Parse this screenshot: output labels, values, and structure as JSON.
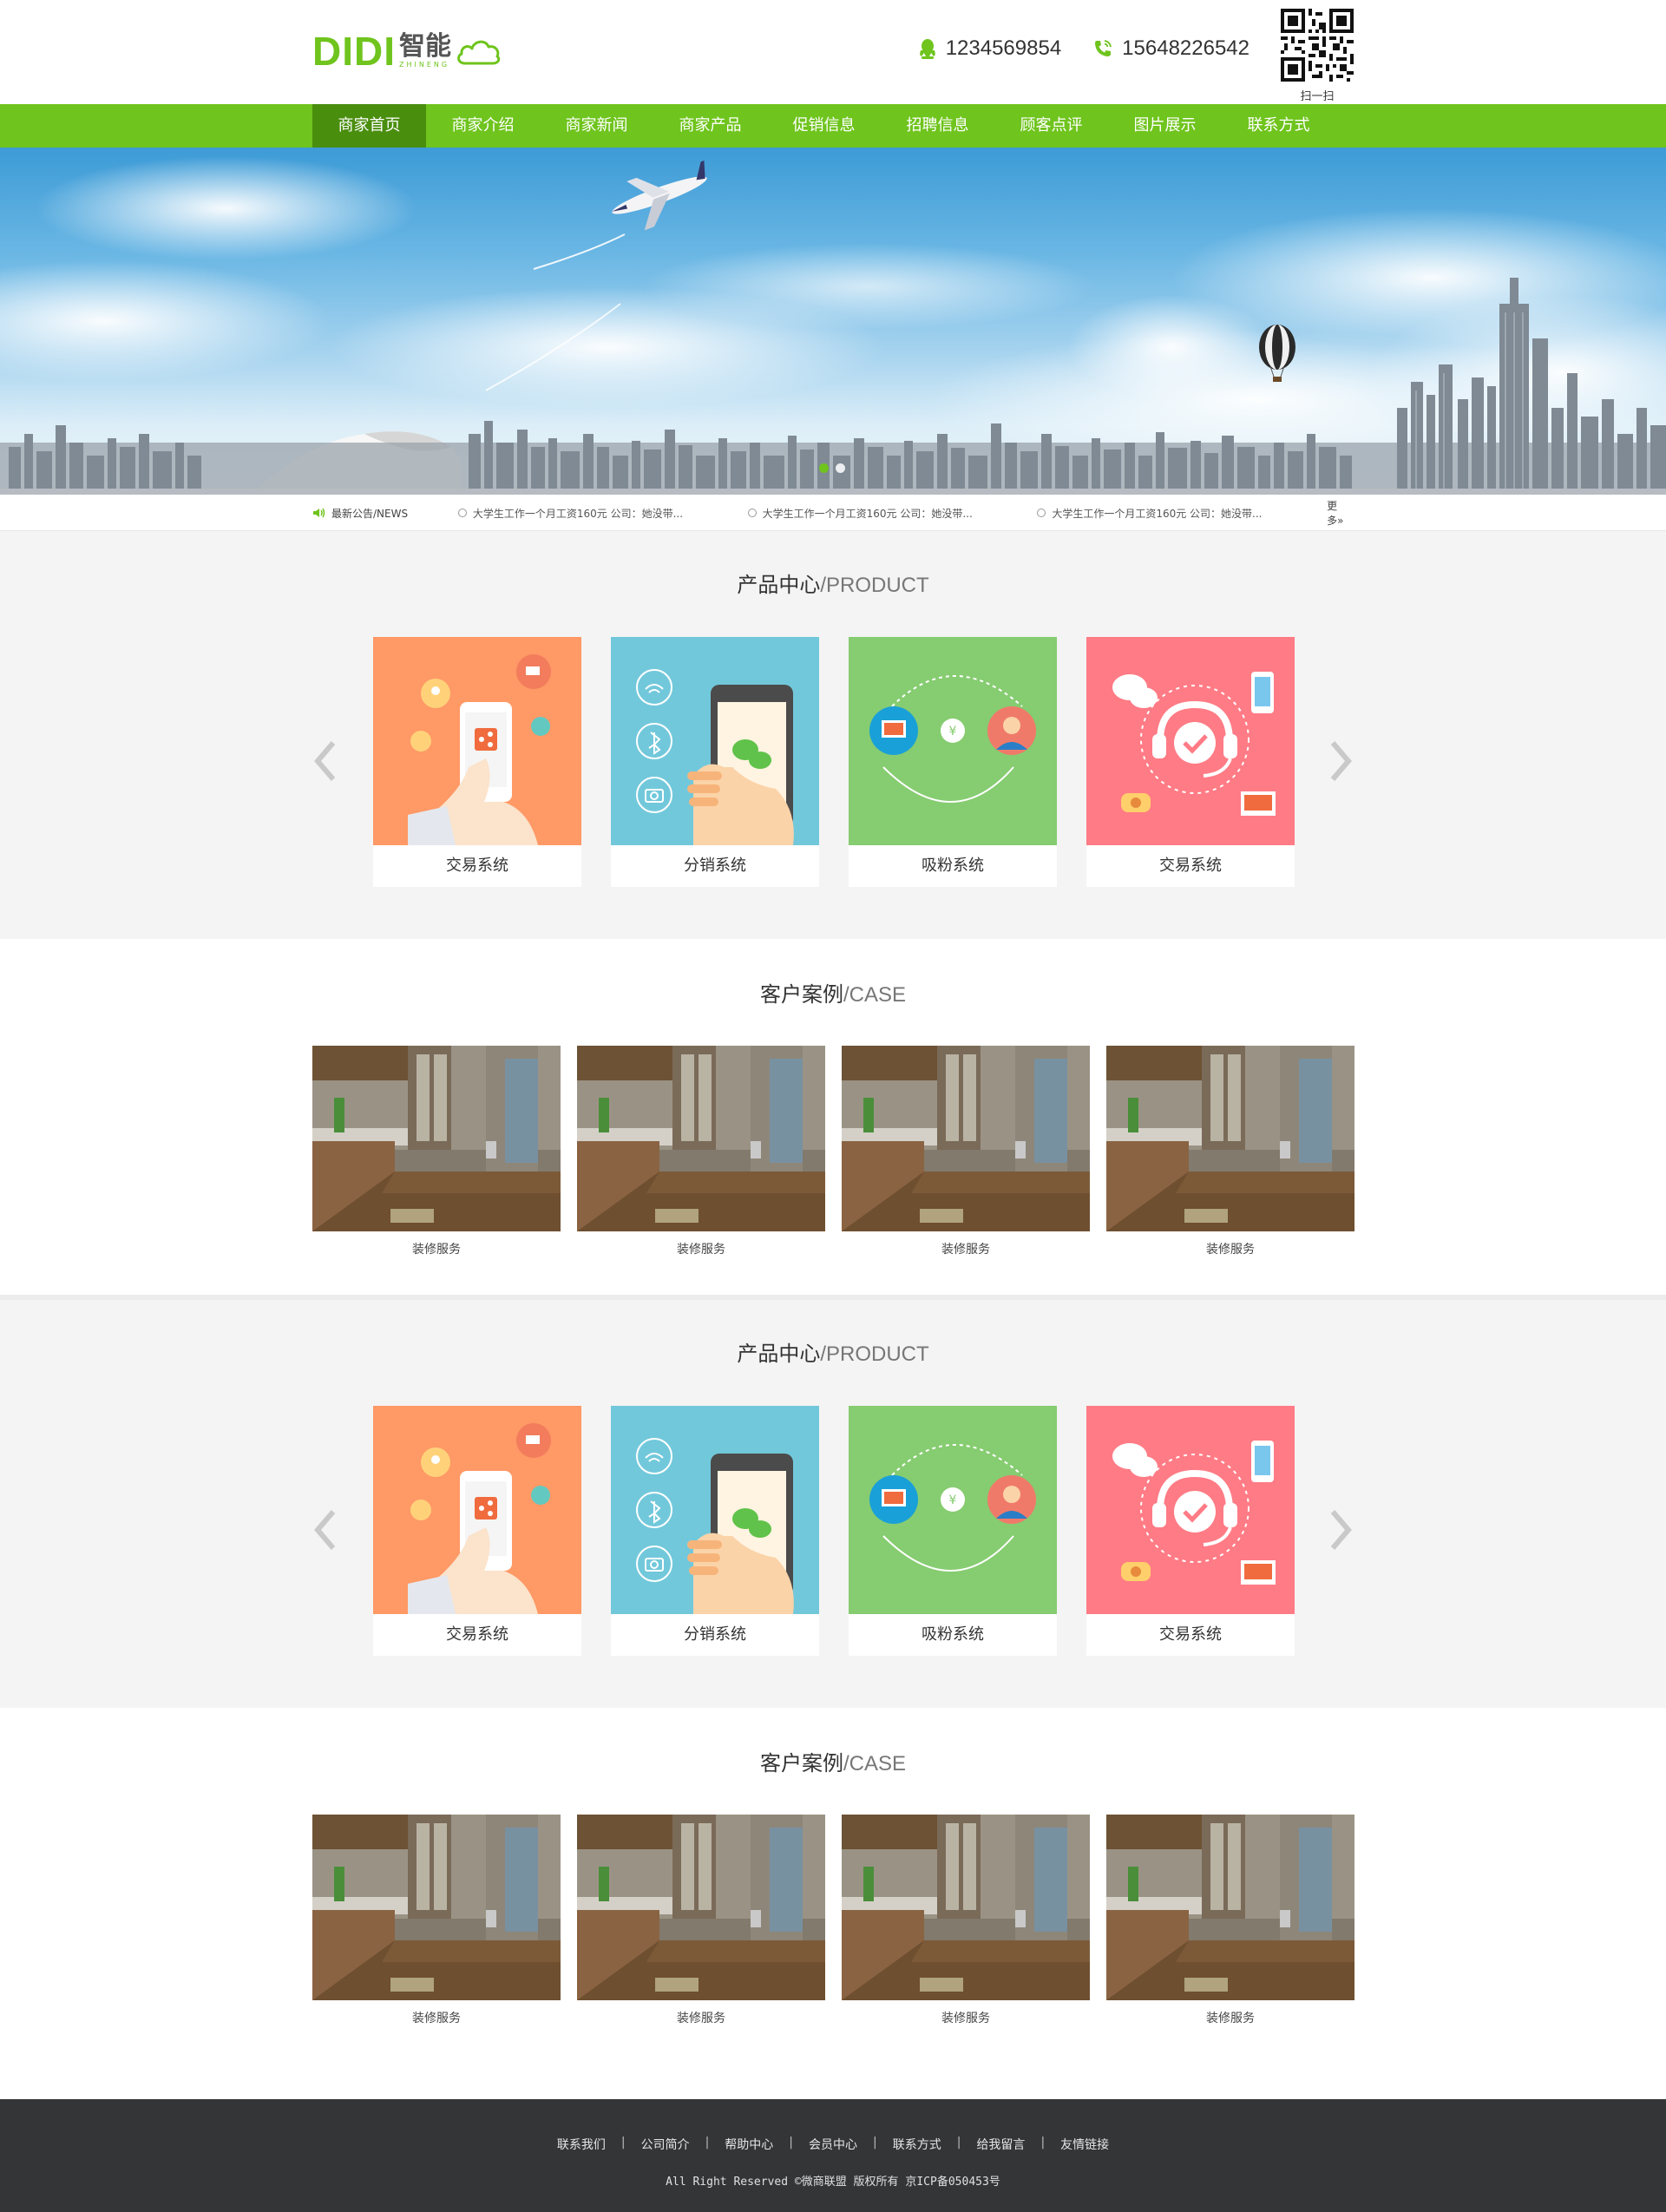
{
  "header": {
    "logo_text": "DIDI",
    "logo_cn": "智能",
    "logo_sub": "ZHINENG",
    "qq_number": "1234569854",
    "phone_number": "15648226542",
    "qr_label": "扫一扫"
  },
  "nav": {
    "items": [
      {
        "label": "商家首页"
      },
      {
        "label": "商家介绍"
      },
      {
        "label": "商家新闻"
      },
      {
        "label": "商家产品"
      },
      {
        "label": "促销信息"
      },
      {
        "label": "招聘信息"
      },
      {
        "label": "顾客点评"
      },
      {
        "label": "图片展示"
      },
      {
        "label": "联系方式"
      }
    ],
    "active_index": 0
  },
  "notice": {
    "title": "最新公告/NEWS",
    "items": [
      {
        "text": "大学生工作一个月工资160元 公司：她没带..."
      },
      {
        "text": "大学生工作一个月工资160元 公司：她没带..."
      },
      {
        "text": "大学生工作一个月工资160元 公司：她没带..."
      }
    ],
    "more": "更多»"
  },
  "products1": {
    "title_cn": "产品中心",
    "title_en": "/PRODUCT",
    "cards": [
      {
        "label": "交易系统"
      },
      {
        "label": "分销系统"
      },
      {
        "label": "吸粉系统"
      },
      {
        "label": "交易系统"
      }
    ]
  },
  "cases1": {
    "title_cn": "客户案例",
    "title_en": "/CASE",
    "items": [
      {
        "label": "装修服务"
      },
      {
        "label": "装修服务"
      },
      {
        "label": "装修服务"
      },
      {
        "label": "装修服务"
      }
    ]
  },
  "products2": {
    "title_cn": "产品中心",
    "title_en": "/PRODUCT",
    "cards": [
      {
        "label": "交易系统"
      },
      {
        "label": "分销系统"
      },
      {
        "label": "吸粉系统"
      },
      {
        "label": "交易系统"
      }
    ]
  },
  "cases2": {
    "title_cn": "客户案例",
    "title_en": "/CASE",
    "items": [
      {
        "label": "装修服务"
      },
      {
        "label": "装修服务"
      },
      {
        "label": "装修服务"
      },
      {
        "label": "装修服务"
      }
    ]
  },
  "footer": {
    "links": [
      {
        "label": "联系我们"
      },
      {
        "label": "公司简介"
      },
      {
        "label": "帮助中心"
      },
      {
        "label": "会员中心"
      },
      {
        "label": "联系方式"
      },
      {
        "label": "给我留言"
      },
      {
        "label": "友情链接"
      }
    ],
    "separator": "|",
    "copyright": "All Right Reserved ©微商联盟 版权所有 京ICP备050453号"
  },
  "colors": {
    "brand_green": "#6fc41d",
    "nav_active": "#4a8e0e",
    "card_orange": "#ff9966",
    "card_blue": "#72c8db",
    "card_green": "#86cc71",
    "card_pink": "#ff7b85",
    "footer_bg": "#333537"
  },
  "icons": {
    "qq": "qq-penguin-icon",
    "phone": "phone-icon",
    "speaker": "speaker-icon",
    "arrow_left": "chevron-left-icon",
    "arrow_right": "chevron-right-icon"
  }
}
